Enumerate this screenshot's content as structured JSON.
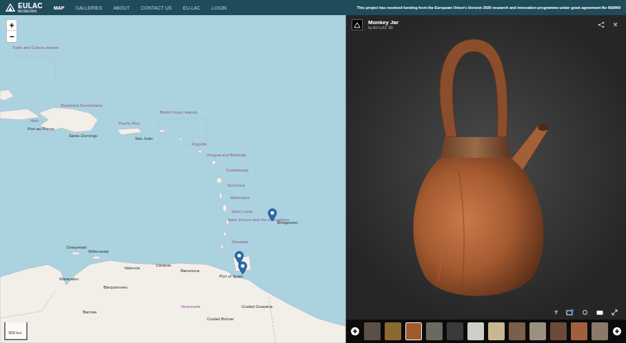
{
  "logo": {
    "title": "EULAC",
    "subtitle": "MUSEUMS"
  },
  "nav": [
    {
      "label": "MAP",
      "selected": true
    },
    {
      "label": "GALLERIES",
      "selected": false
    },
    {
      "label": "ABOUT",
      "selected": false
    },
    {
      "label": "CONTACT US",
      "selected": false
    },
    {
      "label": "EU-LAC",
      "selected": false
    },
    {
      "label": "LOGIN",
      "selected": false
    }
  ],
  "banner": "This project has received funding from the European Union's Horizon 2020 research and innovation programme under grant agreement No 693669",
  "map": {
    "zoom": [
      "+",
      "−"
    ],
    "scale": "300 km",
    "labels": [
      {
        "text": "Turks and Caicos Islands",
        "kind": "country"
      },
      {
        "text": "República Dominicana",
        "kind": "country"
      },
      {
        "text": "Haïti",
        "kind": "country"
      },
      {
        "text": "Port-au-Prince",
        "kind": "city"
      },
      {
        "text": "Santo Domingo",
        "kind": "city"
      },
      {
        "text": "Puerto Rico",
        "kind": "country"
      },
      {
        "text": "San Juan",
        "kind": "city"
      },
      {
        "text": "British Virgin Islands",
        "kind": "country"
      },
      {
        "text": "Anguilla",
        "kind": "country"
      },
      {
        "text": "Antigua and Barbuda",
        "kind": "country"
      },
      {
        "text": "Guadeloupe",
        "kind": "country"
      },
      {
        "text": "Dominica",
        "kind": "country"
      },
      {
        "text": "Martinique",
        "kind": "country"
      },
      {
        "text": "Saint Lucia",
        "kind": "country"
      },
      {
        "text": "Saint Vincent and the Grenadines",
        "kind": "country"
      },
      {
        "text": "Grenada",
        "kind": "country"
      },
      {
        "text": "Bridgetown",
        "kind": "city"
      },
      {
        "text": "Port of Spain",
        "kind": "city"
      },
      {
        "text": "Oranjestad",
        "kind": "city"
      },
      {
        "text": "Willemstad",
        "kind": "city"
      },
      {
        "text": "Maracaibo",
        "kind": "city"
      },
      {
        "text": "Valencia",
        "kind": "city"
      },
      {
        "text": "Caracas",
        "kind": "city"
      },
      {
        "text": "Barcelona",
        "kind": "city"
      },
      {
        "text": "Barquisimeto",
        "kind": "city"
      },
      {
        "text": "Venezuela",
        "kind": "country"
      },
      {
        "text": "Barinas",
        "kind": "city"
      },
      {
        "text": "Ciudad Bolívar",
        "kind": "city"
      },
      {
        "text": "Ciudad Guayana",
        "kind": "city"
      }
    ],
    "markers": [
      {
        "selected": false
      },
      {
        "selected": false
      },
      {
        "selected": false
      }
    ]
  },
  "viewer": {
    "title": "Monkey Jar",
    "subtitle": "by EU-LAC 3D",
    "close": "×",
    "help": "?",
    "thumbnails": [
      {
        "color": "#5a5048",
        "selected": false
      },
      {
        "color": "#8a6a30",
        "selected": false
      },
      {
        "color": "#a05a30",
        "selected": true
      },
      {
        "color": "#6a6a60",
        "selected": false
      },
      {
        "color": "#3a3a3a",
        "selected": false
      },
      {
        "color": "#cfcfc8",
        "selected": false
      },
      {
        "color": "#c8b890",
        "selected": false
      },
      {
        "color": "#7a6048",
        "selected": false
      },
      {
        "color": "#9a9080",
        "selected": false
      },
      {
        "color": "#6a4a38",
        "selected": false
      },
      {
        "color": "#a06040",
        "selected": false
      },
      {
        "color": "#8a7a6a",
        "selected": false
      }
    ]
  }
}
